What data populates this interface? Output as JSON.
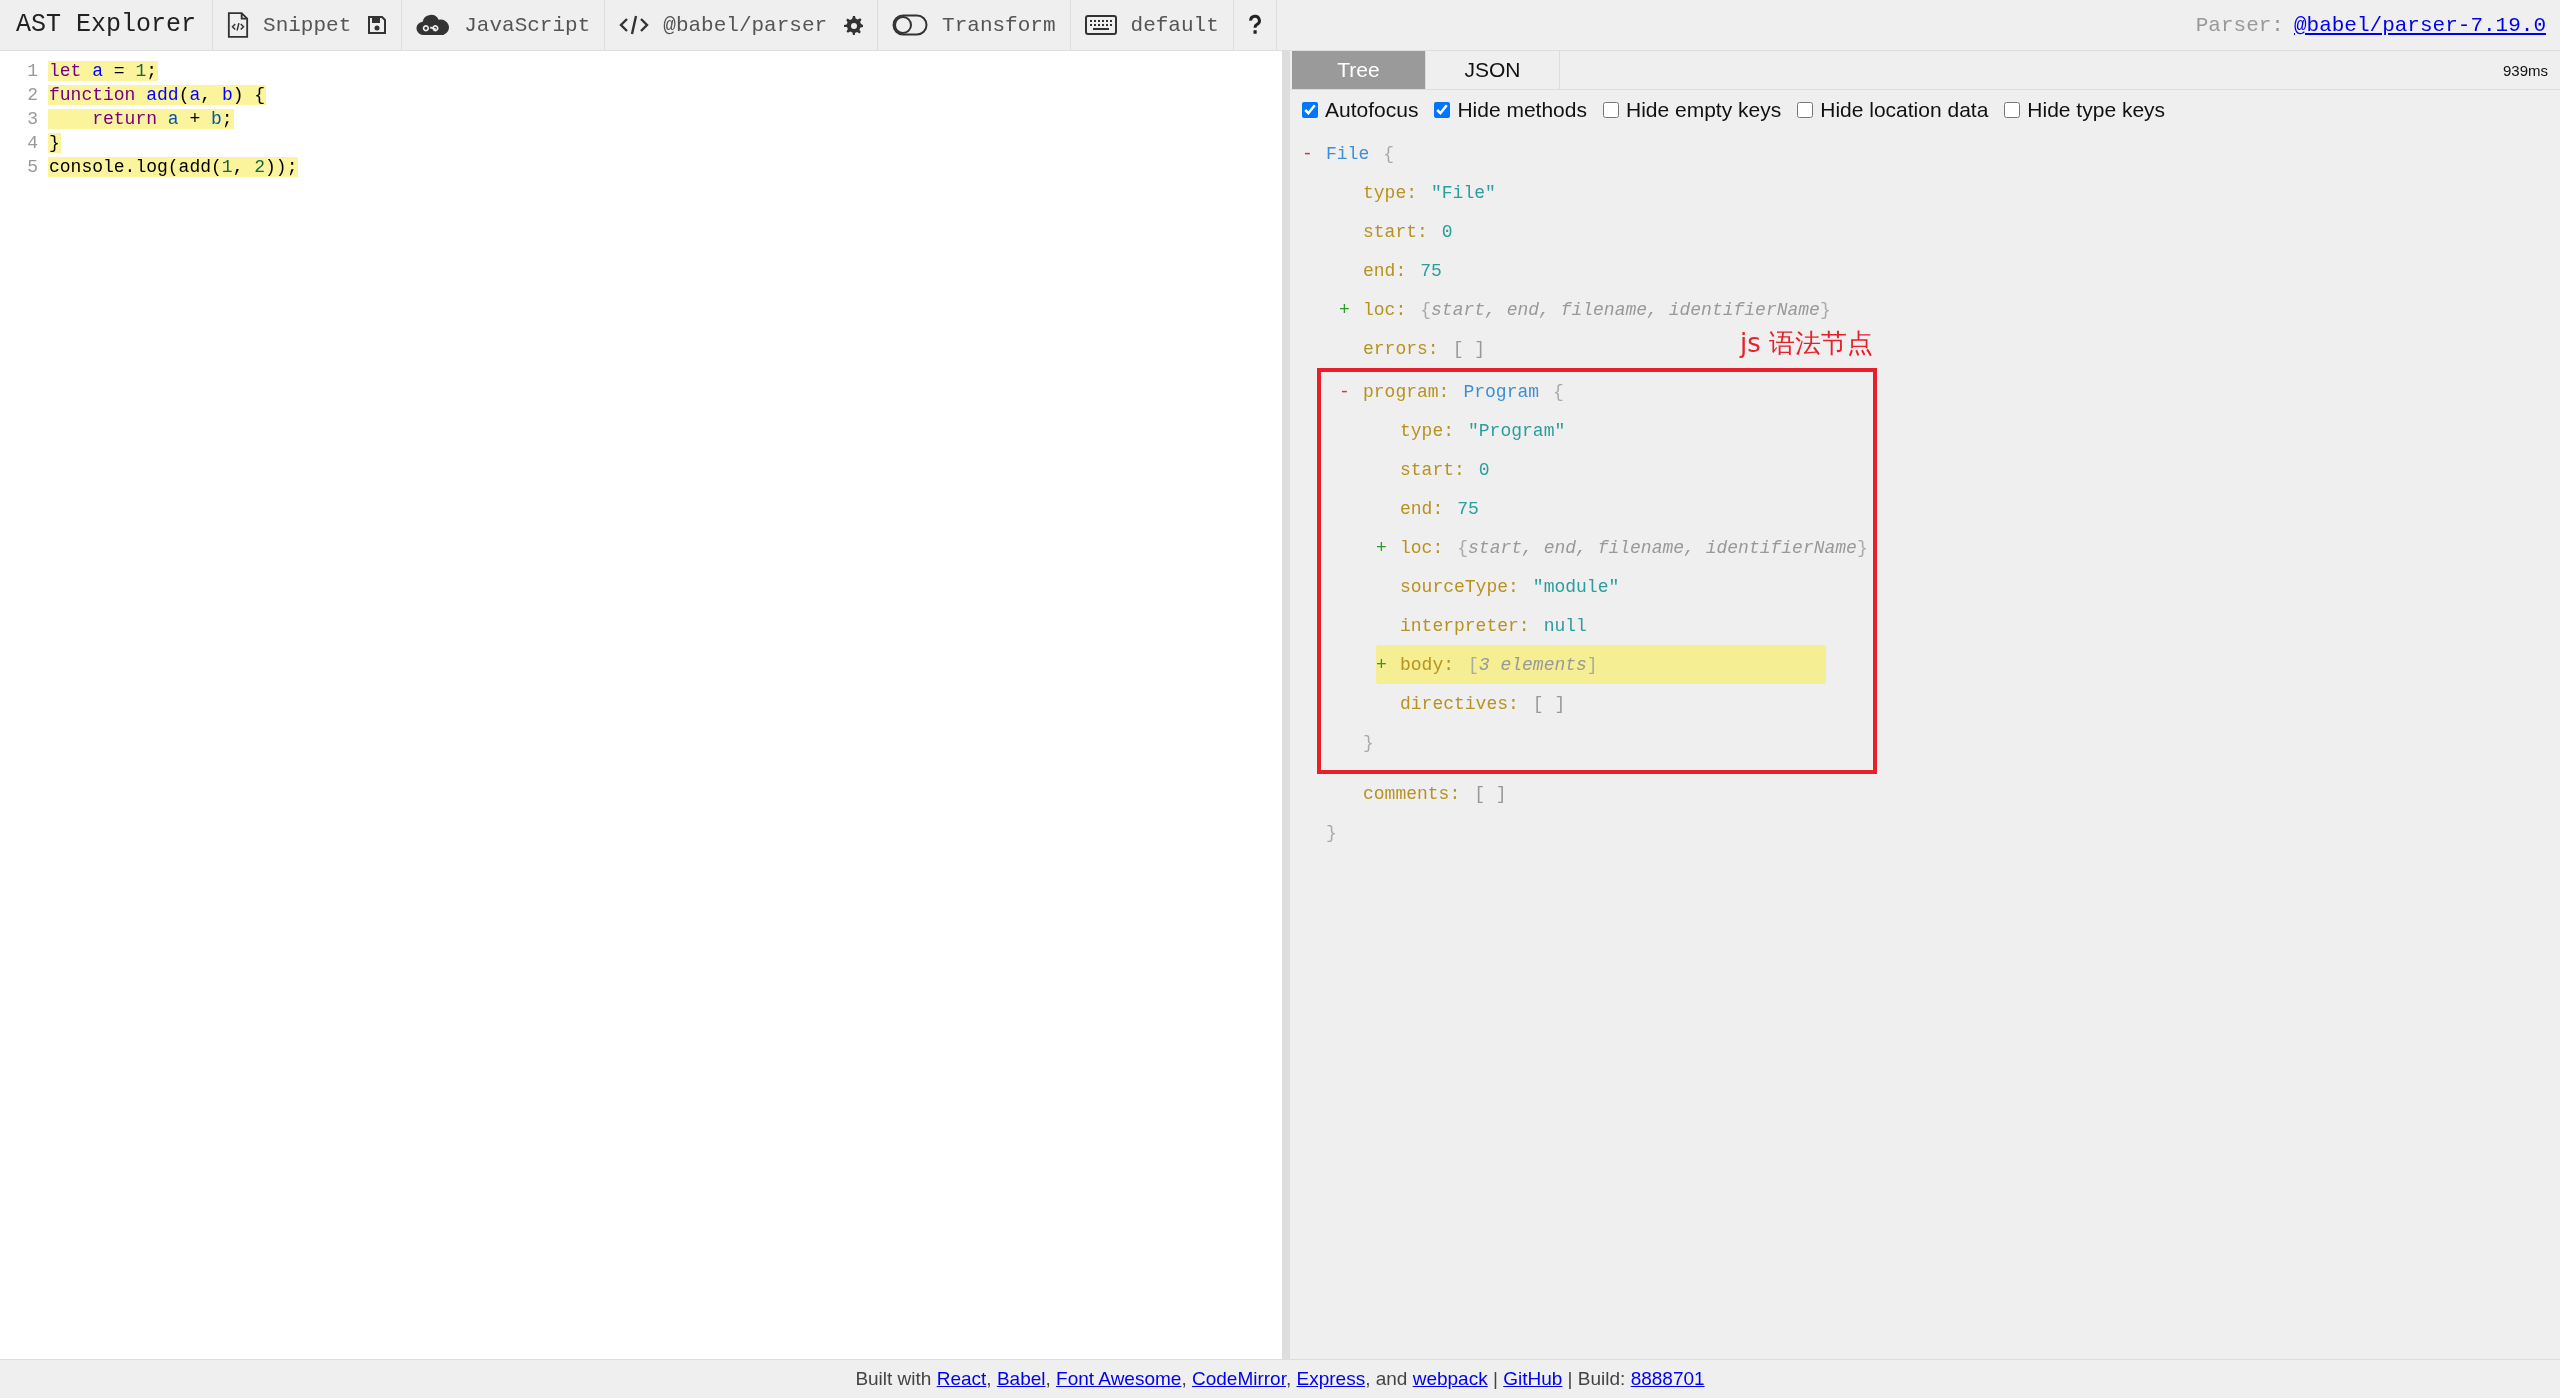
{
  "toolbar": {
    "title": "AST Explorer",
    "groups": [
      [
        {
          "kind": "labeled",
          "label": "Snippet"
        },
        {
          "kind": "icon"
        }
      ],
      [
        {
          "kind": "labeled",
          "label": "JavaScript"
        }
      ],
      [
        {
          "kind": "labeled",
          "label": "@babel/parser"
        },
        {
          "kind": "icon"
        }
      ],
      [
        {
          "kind": "labeled",
          "label": "Transform"
        }
      ],
      [
        {
          "kind": "labeled",
          "label": "default"
        }
      ],
      [
        {
          "kind": "help"
        }
      ]
    ],
    "parser_label": "Parser:",
    "parser_link": "@babel/parser-7.19.0"
  },
  "editor": {
    "lines": [
      {
        "number": "1",
        "highlighted": true,
        "tokens": [
          {
            "text": "let",
            "kind": "keyword"
          },
          {
            "text": " a",
            "kind": "def"
          },
          {
            "text": " = "
          },
          {
            "text": "1",
            "kind": "number"
          },
          {
            "text": ";"
          }
        ]
      },
      {
        "number": "2",
        "highlighted": true,
        "tokens": [
          {
            "text": "function",
            "kind": "keyword"
          },
          {
            "text": " add",
            "kind": "def"
          },
          {
            "text": "("
          },
          {
            "text": "a",
            "kind": "def"
          },
          {
            "text": ", "
          },
          {
            "text": "b",
            "kind": "def"
          },
          {
            "text": ") {"
          }
        ]
      },
      {
        "number": "3",
        "highlighted": true,
        "tokens": [
          {
            "text": "    return",
            "kind": "keyword"
          },
          {
            "text": " a",
            "kind": "var"
          },
          {
            "text": " + "
          },
          {
            "text": "b",
            "kind": "var"
          },
          {
            "text": ";"
          }
        ]
      },
      {
        "number": "4",
        "highlighted": true,
        "tokens": [
          {
            "text": "}"
          }
        ]
      },
      {
        "number": "5",
        "highlighted": true,
        "tokens": [
          {
            "text": "console.log(add("
          },
          {
            "text": "1",
            "kind": "number"
          },
          {
            "text": ", "
          },
          {
            "text": "2",
            "kind": "number"
          },
          {
            "text": "));"
          }
        ]
      }
    ]
  },
  "output": {
    "tabs": [
      {
        "label": "Tree",
        "selected": true
      },
      {
        "label": "JSON",
        "selected": false
      }
    ],
    "time": "939ms",
    "options": [
      {
        "label": "Autofocus",
        "checked": true
      },
      {
        "label": "Hide methods",
        "checked": true
      },
      {
        "label": "Hide empty keys",
        "checked": false
      },
      {
        "label": "Hide location data",
        "checked": false
      },
      {
        "label": "Hide type keys",
        "checked": false
      }
    ],
    "tree": {
      "kind": "object",
      "toggle": "-",
      "label": "File",
      "open": "{",
      "close": "}",
      "expanded": true,
      "children": [
        {
          "kind": "string",
          "key": "type:",
          "value": "\"File\""
        },
        {
          "kind": "number",
          "key": "start:",
          "value": "0"
        },
        {
          "kind": "number",
          "key": "end:",
          "value": "75"
        },
        {
          "kind": "object",
          "toggle": "+",
          "key": "loc:",
          "summary_open": "{",
          "summary": "start, end, filename, identifierName",
          "summary_close": "}",
          "expanded": false
        },
        {
          "kind": "empty",
          "key": "errors:",
          "value": "[ ]"
        },
        {
          "kind": "object",
          "toggle": "-",
          "key": "program:",
          "label": "Program",
          "open": "{",
          "close": "}",
          "expanded": true,
          "annotation": "js 语法节点",
          "children": [
            {
              "kind": "string",
              "key": "type:",
              "value": "\"Program\""
            },
            {
              "kind": "number",
              "key": "start:",
              "value": "0"
            },
            {
              "kind": "number",
              "key": "end:",
              "value": "75"
            },
            {
              "kind": "object",
              "toggle": "+",
              "key": "loc:",
              "summary_open": "{",
              "summary": "start, end, filename, identifierName",
              "summary_close": "}",
              "expanded": false
            },
            {
              "kind": "string",
              "key": "sourceType:",
              "value": "\"module\""
            },
            {
              "kind": "number",
              "key": "interpreter:",
              "value": "null"
            },
            {
              "kind": "object",
              "toggle": "+",
              "key": "body:",
              "summary_open": "[",
              "summary": "3 elements",
              "summary_close": "]",
              "expanded": false,
              "highlighted": true
            },
            {
              "kind": "empty",
              "key": "directives:",
              "value": "[ ]"
            }
          ]
        },
        {
          "kind": "empty",
          "key": "comments:",
          "value": "[ ]"
        }
      ]
    }
  },
  "footer": [
    {
      "text": "Built with "
    },
    {
      "link": "React"
    },
    {
      "text": ", "
    },
    {
      "link": "Babel"
    },
    {
      "text": ", "
    },
    {
      "link": "Font Awesome"
    },
    {
      "text": ", "
    },
    {
      "link": "CodeMirror"
    },
    {
      "text": ", "
    },
    {
      "link": "Express"
    },
    {
      "text": ", and "
    },
    {
      "link": "webpack"
    },
    {
      "text": " | "
    },
    {
      "link": "GitHub"
    },
    {
      "text": " | Build: "
    },
    {
      "link": "8888701"
    }
  ]
}
